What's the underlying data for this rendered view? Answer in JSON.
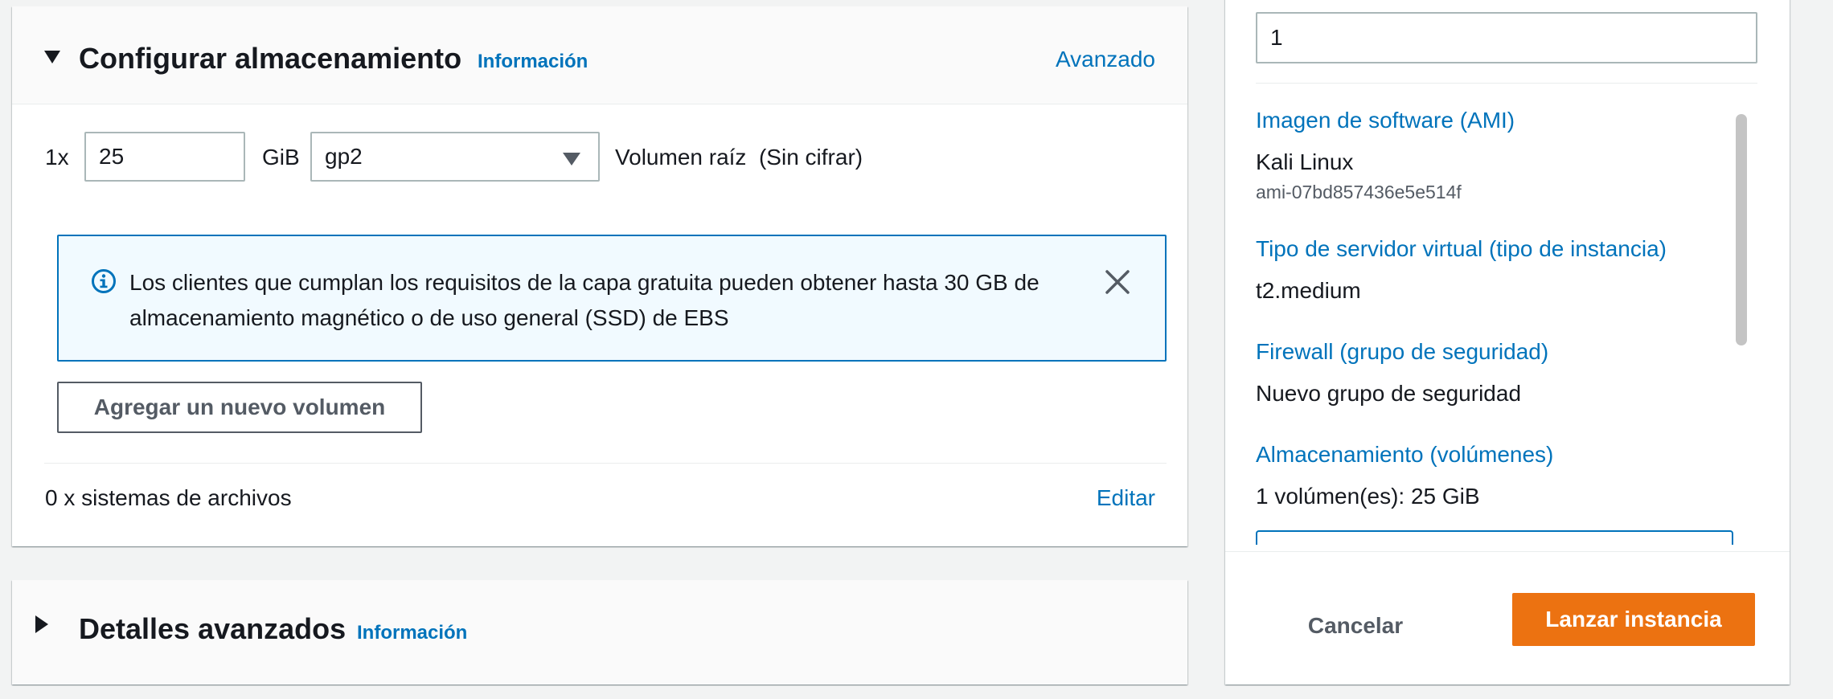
{
  "storage": {
    "title": "Configurar almacenamiento",
    "info_link": "Información",
    "advanced_link": "Avanzado",
    "volume": {
      "multiplier": "1x",
      "size_value": "25",
      "unit": "GiB",
      "type_value": "gp2",
      "description": "Volumen raíz  (Sin cifrar)"
    },
    "alert": {
      "text": "Los clientes que cumplan los requisitos de la capa gratuita pueden obtener hasta 30 GB de almacenamiento magnético o de uso general (SSD) de EBS"
    },
    "add_volume_label": "Agregar un nuevo volumen",
    "filesystems_text": "0 x sistemas de archivos",
    "edit_link": "Editar"
  },
  "advanced": {
    "title": "Detalles avanzados",
    "info_link": "Información"
  },
  "summary": {
    "instances_value": "1",
    "items": [
      {
        "label": "Imagen de software (AMI)",
        "value": "Kali Linux",
        "sub": "ami-07bd857436e5e514f"
      },
      {
        "label": "Tipo de servidor virtual (tipo de instancia)",
        "value": "t2.medium"
      },
      {
        "label": "Firewall (grupo de seguridad)",
        "value": "Nuevo grupo de seguridad"
      },
      {
        "label": "Almacenamiento (volúmenes)",
        "value": "1 volúmen(es): 25 GiB"
      }
    ],
    "cancel_label": "Cancelar",
    "launch_label": "Lanzar instancia"
  },
  "colors": {
    "link": "#0073bb",
    "primary_button": "#ec7211",
    "alert_bg": "#f1faff",
    "alert_border": "#0073bb"
  }
}
